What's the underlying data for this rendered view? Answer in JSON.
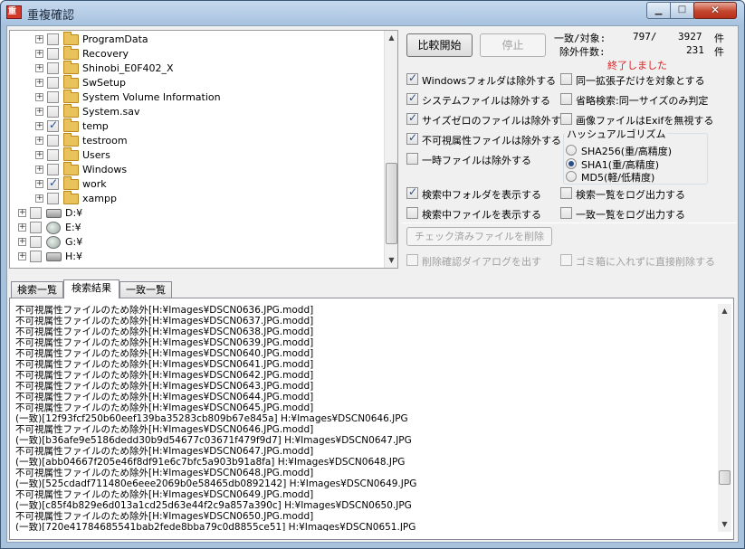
{
  "window": {
    "title": "重複確認"
  },
  "tree": {
    "items": [
      {
        "label": "ProgramData",
        "checked": false,
        "kind": "folder",
        "depth": 1
      },
      {
        "label": "Recovery",
        "checked": false,
        "kind": "folder",
        "depth": 1
      },
      {
        "label": "Shinobi_E0F402_X",
        "checked": false,
        "kind": "folder",
        "depth": 1
      },
      {
        "label": "SwSetup",
        "checked": false,
        "kind": "folder",
        "depth": 1
      },
      {
        "label": "System Volume Information",
        "checked": false,
        "kind": "folder",
        "depth": 1
      },
      {
        "label": "System.sav",
        "checked": false,
        "kind": "folder",
        "depth": 1
      },
      {
        "label": "temp",
        "checked": true,
        "kind": "folder",
        "depth": 1
      },
      {
        "label": "testroom",
        "checked": false,
        "kind": "folder",
        "depth": 1
      },
      {
        "label": "Users",
        "checked": false,
        "kind": "folder",
        "depth": 1
      },
      {
        "label": "Windows",
        "checked": false,
        "kind": "folder",
        "depth": 1
      },
      {
        "label": "work",
        "checked": true,
        "kind": "folder",
        "depth": 1
      },
      {
        "label": "xampp",
        "checked": false,
        "kind": "folder",
        "depth": 1
      },
      {
        "label": "D:¥",
        "checked": false,
        "kind": "drive",
        "depth": 0
      },
      {
        "label": "E:¥",
        "checked": false,
        "kind": "cd",
        "depth": 0
      },
      {
        "label": "G:¥",
        "checked": false,
        "kind": "net",
        "depth": 0
      },
      {
        "label": "H:¥",
        "checked": false,
        "kind": "drive",
        "depth": 0
      }
    ]
  },
  "toolbar": {
    "compare_label": "比較開始",
    "stop_label": "停止",
    "delete_checked_label": "チェック済みファイルを削除"
  },
  "stats": {
    "match_label": "一致/対象:",
    "match_count": "797/",
    "target_count": "3927",
    "unit1": "件",
    "excluded_label": "除外件数:",
    "excluded_count": "231",
    "unit2": "件",
    "status": "終了しました"
  },
  "options": {
    "exclude_windows": {
      "label": "Windowsフォルダは除外する",
      "checked": true
    },
    "exclude_system": {
      "label": "システムファイルは除外する",
      "checked": true
    },
    "exclude_zero": {
      "label": "サイズゼロのファイルは除外する",
      "checked": true
    },
    "exclude_hidden": {
      "label": "不可視属性ファイルは除外する",
      "checked": true
    },
    "exclude_temp": {
      "label": "一時ファイルは除外する",
      "checked": false
    },
    "same_ext": {
      "label": "同一拡張子だけを対象とする",
      "checked": false
    },
    "omit_search": {
      "label": "省略検索:同一サイズのみ判定",
      "checked": false
    },
    "ignore_exif": {
      "label": "画像ファイルはExifを無視する",
      "checked": false
    },
    "show_folder": {
      "label": "検索中フォルダを表示する",
      "checked": true
    },
    "show_file": {
      "label": "検索中ファイルを表示する",
      "checked": false
    },
    "log_search": {
      "label": "検索一覧をログ出力する",
      "checked": false
    },
    "log_match": {
      "label": "一致一覧をログ出力する",
      "checked": false
    },
    "confirm_dialog": {
      "label": "削除確認ダイアログを出す",
      "checked": false
    },
    "direct_delete": {
      "label": "ゴミ箱に入れずに直接削除する",
      "checked": false
    }
  },
  "hash": {
    "legend": "ハッシュアルゴリズム",
    "options": [
      {
        "label": "SHA256(重/高精度)",
        "selected": false
      },
      {
        "label": "SHA1(重/高精度)",
        "selected": true
      },
      {
        "label": "MD5(軽/低精度)",
        "selected": false
      }
    ]
  },
  "tabs": [
    {
      "label": "検索一覧",
      "active": false
    },
    {
      "label": "検索結果",
      "active": true
    },
    {
      "label": "一致一覧",
      "active": false
    }
  ],
  "log": [
    "不可視属性ファイルのため除外[H:¥Images¥DSCN0636.JPG.modd]",
    "不可視属性ファイルのため除外[H:¥Images¥DSCN0637.JPG.modd]",
    "不可視属性ファイルのため除外[H:¥Images¥DSCN0638.JPG.modd]",
    "不可視属性ファイルのため除外[H:¥Images¥DSCN0639.JPG.modd]",
    "不可視属性ファイルのため除外[H:¥Images¥DSCN0640.JPG.modd]",
    "不可視属性ファイルのため除外[H:¥Images¥DSCN0641.JPG.modd]",
    "不可視属性ファイルのため除外[H:¥Images¥DSCN0642.JPG.modd]",
    "不可視属性ファイルのため除外[H:¥Images¥DSCN0643.JPG.modd]",
    "不可視属性ファイルのため除外[H:¥Images¥DSCN0644.JPG.modd]",
    "不可視属性ファイルのため除外[H:¥Images¥DSCN0645.JPG.modd]",
    "(一致)[12f93fcf250b60eef139ba35283cb809b67e845a]  H:¥Images¥DSCN0646.JPG",
    "不可視属性ファイルのため除外[H:¥Images¥DSCN0646.JPG.modd]",
    "(一致)[b36afe9e5186dedd30b9d54677c03671f479f9d7]  H:¥Images¥DSCN0647.JPG",
    "不可視属性ファイルのため除外[H:¥Images¥DSCN0647.JPG.modd]",
    "(一致)[abb04667f205e46f8df91e6c7bfc5a903b91a8fa]  H:¥Images¥DSCN0648.JPG",
    "不可視属性ファイルのため除外[H:¥Images¥DSCN0648.JPG.modd]",
    "(一致)[525cdadf711480e6eee2069b0e58465db0892142]  H:¥Images¥DSCN0649.JPG",
    "不可視属性ファイルのため除外[H:¥Images¥DSCN0649.JPG.modd]",
    "(一致)[c85f4b829e6d013a1cd25d63e44f2c9a857a390c]  H:¥Images¥DSCN0650.JPG",
    "不可視属性ファイルのため除外[H:¥Images¥DSCN0650.JPG.modd]",
    "(一致)[720e41784685541bab2fede8bba79c0d8855ce51]  H:¥Images¥DSCN0651.JPG"
  ]
}
